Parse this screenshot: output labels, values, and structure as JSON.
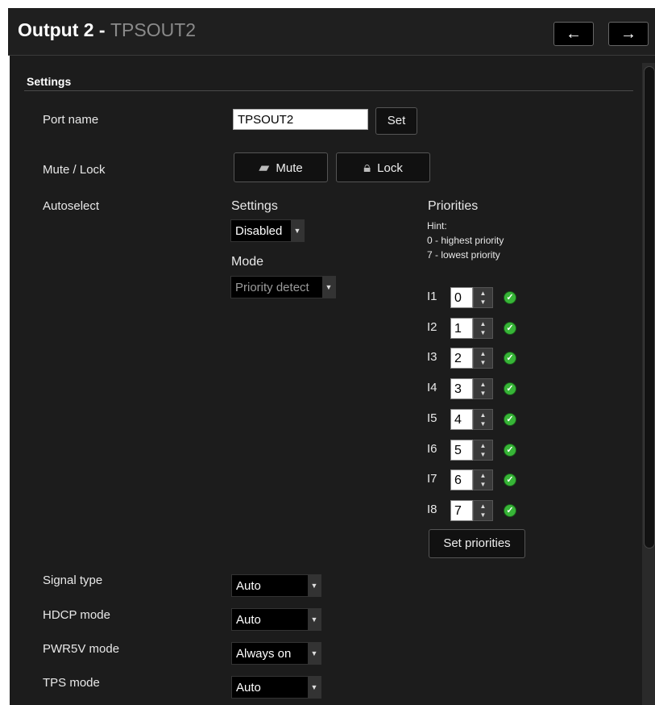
{
  "header": {
    "title_bold": "Output 2",
    "title_sep": " - ",
    "title_sub": "TPSOUT2",
    "prev_icon": "←",
    "next_icon": "→"
  },
  "settings": {
    "section_title": "Settings",
    "port_name_label": "Port name",
    "port_name_value": "TPSOUT2",
    "set_label": "Set",
    "mute_lock_label": "Mute / Lock",
    "mute_label": "Mute",
    "lock_label": "Lock",
    "autoselect_label": "Autoselect",
    "autoselect_settings_label": "Settings",
    "autoselect_settings_value": "Disabled",
    "mode_label": "Mode",
    "mode_value": "Priority detect",
    "priorities_label": "Priorities",
    "hint_title": "Hint:",
    "hint_line1": "0 - highest priority",
    "hint_line2": "7 - lowest priority",
    "priorities": [
      {
        "input": "I1",
        "value": "0"
      },
      {
        "input": "I2",
        "value": "1"
      },
      {
        "input": "I3",
        "value": "2"
      },
      {
        "input": "I4",
        "value": "3"
      },
      {
        "input": "I5",
        "value": "4"
      },
      {
        "input": "I6",
        "value": "5"
      },
      {
        "input": "I7",
        "value": "6"
      },
      {
        "input": "I8",
        "value": "7"
      }
    ],
    "set_priorities_label": "Set priorities",
    "signal_type_label": "Signal type",
    "signal_type_value": "Auto",
    "hdcp_mode_label": "HDCP mode",
    "hdcp_mode_value": "Auto",
    "pwr5v_mode_label": "PWR5V mode",
    "pwr5v_mode_value": "Always on",
    "tps_mode_label": "TPS mode",
    "tps_mode_value": "Auto"
  },
  "colors": {
    "background": "#1c1c1c",
    "status_ok": "#37b537"
  },
  "icons": {
    "mute": "mute-icon",
    "lock": "lock-icon",
    "check": "check-icon"
  }
}
